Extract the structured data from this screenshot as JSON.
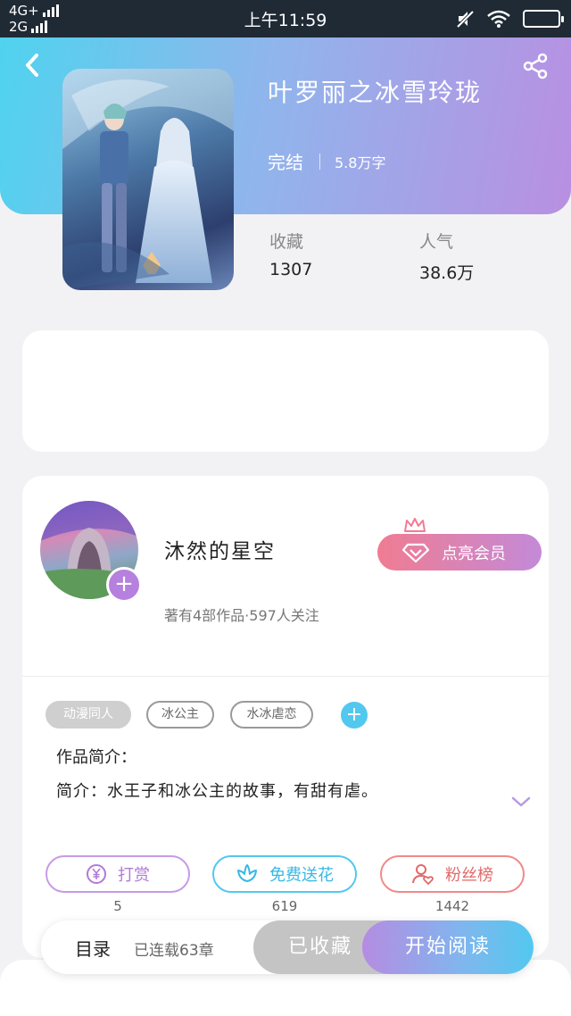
{
  "status_bar": {
    "network_top": "4G+",
    "network_bottom": "2G",
    "time": "上午11:59"
  },
  "book": {
    "title": "叶罗丽之冰雪玲珑",
    "status": "完结",
    "word_count": "5.8万字",
    "favorites_label": "收藏",
    "favorites_value": "1307",
    "popularity_label": "人气",
    "popularity_value": "38.6万"
  },
  "author": {
    "name": "沐然的星空",
    "stats": "著有4部作品·597人关注",
    "member_button": "点亮会员"
  },
  "tags": [
    "动漫同人",
    "冰公主",
    "水冰虐恋"
  ],
  "intro": {
    "heading": "作品简介：",
    "text": "简介：水王子和冰公主的故事，有甜有虐。"
  },
  "actions": [
    {
      "label": "打赏",
      "count": "5",
      "color": "#b17ad8"
    },
    {
      "label": "免费送花",
      "count": "619",
      "color": "#38b8e5"
    },
    {
      "label": "粉丝榜",
      "count": "1442",
      "color": "#e06a6a"
    }
  ],
  "bottom_bar": {
    "toc_label": "目录",
    "chapters": "已连载63章",
    "collected": "已收藏",
    "read": "开始阅读"
  },
  "icons": {
    "back": "chevron-left-icon",
    "share": "share-icon",
    "crown": "crown-icon",
    "diamond": "diamond-icon",
    "expand": "chevron-down-icon",
    "reward": "yen-coin-icon",
    "flower": "flower-icon",
    "fans": "user-heart-icon"
  },
  "colors": {
    "header_gradient_start": "#4fd3ee",
    "header_gradient_end": "#b98fe2",
    "accent_purple": "#b680de",
    "accent_blue": "#52c8ef"
  }
}
